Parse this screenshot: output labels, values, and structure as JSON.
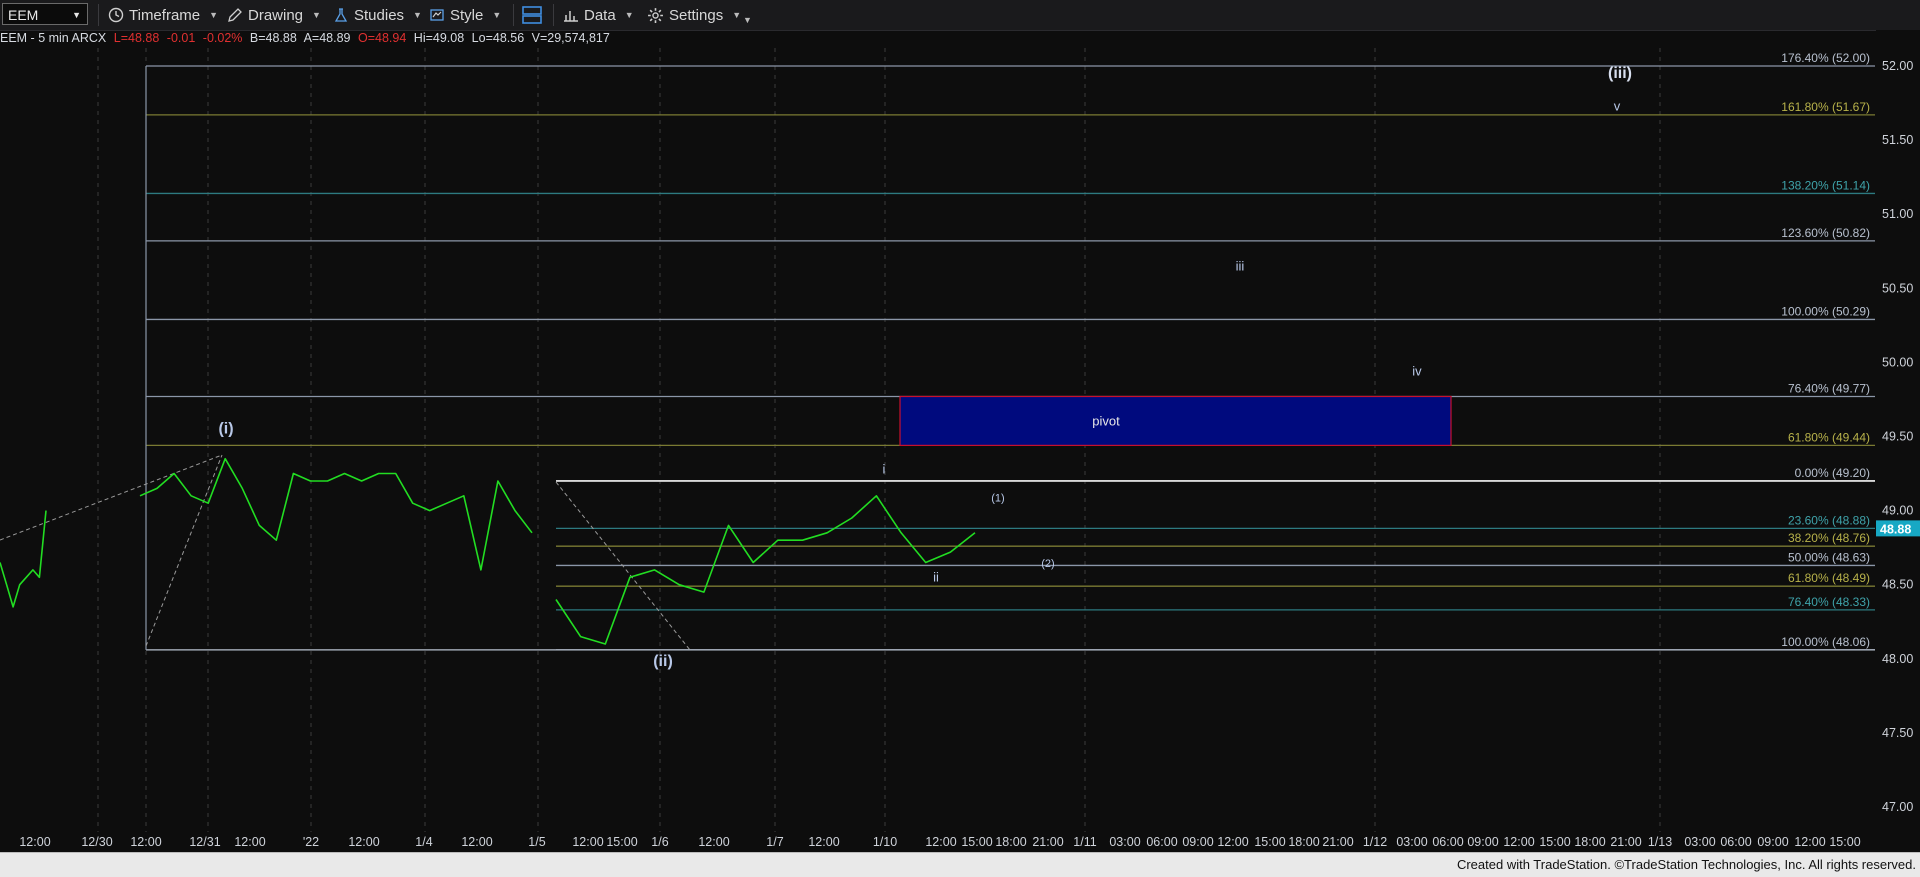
{
  "toolbar": {
    "symbol": "EEM",
    "items": [
      {
        "label": "Timeframe",
        "icon": "clock-icon"
      },
      {
        "label": "Drawing",
        "icon": "pen-icon"
      },
      {
        "label": "Studies",
        "icon": "flask-icon"
      },
      {
        "label": "Style",
        "icon": "style-icon"
      },
      {
        "label": "",
        "icon": "layout-icon"
      },
      {
        "label": "Data",
        "icon": "bar-data-icon"
      },
      {
        "label": "Settings",
        "icon": "gear-icon"
      }
    ]
  },
  "info": {
    "instrument": "EEM - 5 min ARCX",
    "last": "L=48.88",
    "change": "-0.01",
    "change_pct": "-0.02%",
    "bid": "B=48.88",
    "ask": "A=48.89",
    "open": "O=48.94",
    "high": "Hi=49.08",
    "low": "Lo=48.56",
    "volume": "V=29,574,817"
  },
  "footer": {
    "text": "Created with TradeStation. ©TradeStation Technologies, Inc. All rights reserved."
  },
  "colors": {
    "background": "#0d0d0d",
    "price_line": "#22dd22",
    "fib_grey": "#8b96a8",
    "fib_olive": "#7a7a32",
    "fib_teal": "#2d7a80",
    "pivot_fill": "#000a7e",
    "pivot_border": "#c8102e",
    "last_price_tag": "#17a8c4"
  },
  "chart_data": {
    "type": "line",
    "symbol": "EEM",
    "interval": "5 min",
    "ylim": [
      46.85,
      52.2
    ],
    "y_ticks": [
      "52.00",
      "51.50",
      "51.00",
      "50.50",
      "50.00",
      "49.50",
      "49.00",
      "48.50",
      "48.00",
      "47.50",
      "47.00"
    ],
    "x_ticks": [
      "12:00",
      "12/30",
      "12:00",
      "12/31",
      "12:00",
      "'22",
      "12:00",
      "1/4",
      "12:00",
      "1/5",
      "12:00",
      "15:00",
      "1/6",
      "12:00",
      "1/7",
      "12:00",
      "1/10",
      "12:00",
      "15:00",
      "18:00",
      "21:00",
      "1/11",
      "03:00",
      "06:00",
      "09:00",
      "12:00",
      "15:00",
      "18:00",
      "21:00",
      "1/12",
      "03:00",
      "06:00",
      "09:00",
      "12:00",
      "15:00",
      "18:00",
      "21:00",
      "1/13",
      "03:00",
      "06:00",
      "09:00",
      "12:00",
      "15:00"
    ],
    "last_price": "48.88",
    "series": [
      {
        "name": "EEM",
        "values": [
          48.65,
          48.5,
          48.35,
          48.5,
          48.55,
          48.6,
          48.55,
          49.0,
          49.1,
          49.15,
          49.25,
          49.1,
          49.05,
          49.35,
          49.15,
          48.9,
          48.8,
          49.25,
          49.2,
          49.2,
          49.25,
          49.2,
          49.25,
          49.25,
          49.05,
          49.0,
          49.05,
          49.1,
          48.6,
          49.2,
          49.0,
          48.85,
          48.4,
          48.15,
          48.1,
          48.55,
          48.6,
          48.5,
          48.45,
          48.9,
          48.65,
          48.8,
          48.8,
          48.85,
          48.95,
          49.1,
          48.85,
          48.65,
          48.72,
          48.85
        ]
      }
    ],
    "fib_levels_upper": [
      {
        "label": "176.40% (52.00)",
        "value": 52.0
      },
      {
        "label": "161.80% (51.67)",
        "value": 51.67
      },
      {
        "label": "138.20% (51.14)",
        "value": 51.14
      },
      {
        "label": "123.60% (50.82)",
        "value": 50.82
      },
      {
        "label": "100.00% (50.29)",
        "value": 50.29
      },
      {
        "label": "76.40% (49.77)",
        "value": 49.77
      },
      {
        "label": "61.80% (49.44)",
        "value": 49.44
      }
    ],
    "fib_levels_lower": [
      {
        "label": "0.00% (49.20)",
        "value": 49.2
      },
      {
        "label": "23.60% (48.88)",
        "value": 48.88
      },
      {
        "label": "38.20% (48.76)",
        "value": 48.76
      },
      {
        "label": "50.00% (48.63)",
        "value": 48.63
      },
      {
        "label": "61.80% (48.49)",
        "value": 48.49
      },
      {
        "label": "76.40% (48.33)",
        "value": 48.33
      },
      {
        "label": "100.00% (48.06)",
        "value": 48.06
      }
    ],
    "pivot": {
      "label": "pivot",
      "low": 49.44,
      "high": 49.77
    },
    "wave_labels": [
      "(i)",
      "(ii)",
      "i",
      "ii",
      "(1)",
      "(2)",
      "iii",
      "iv",
      "v",
      "(iii)"
    ]
  }
}
